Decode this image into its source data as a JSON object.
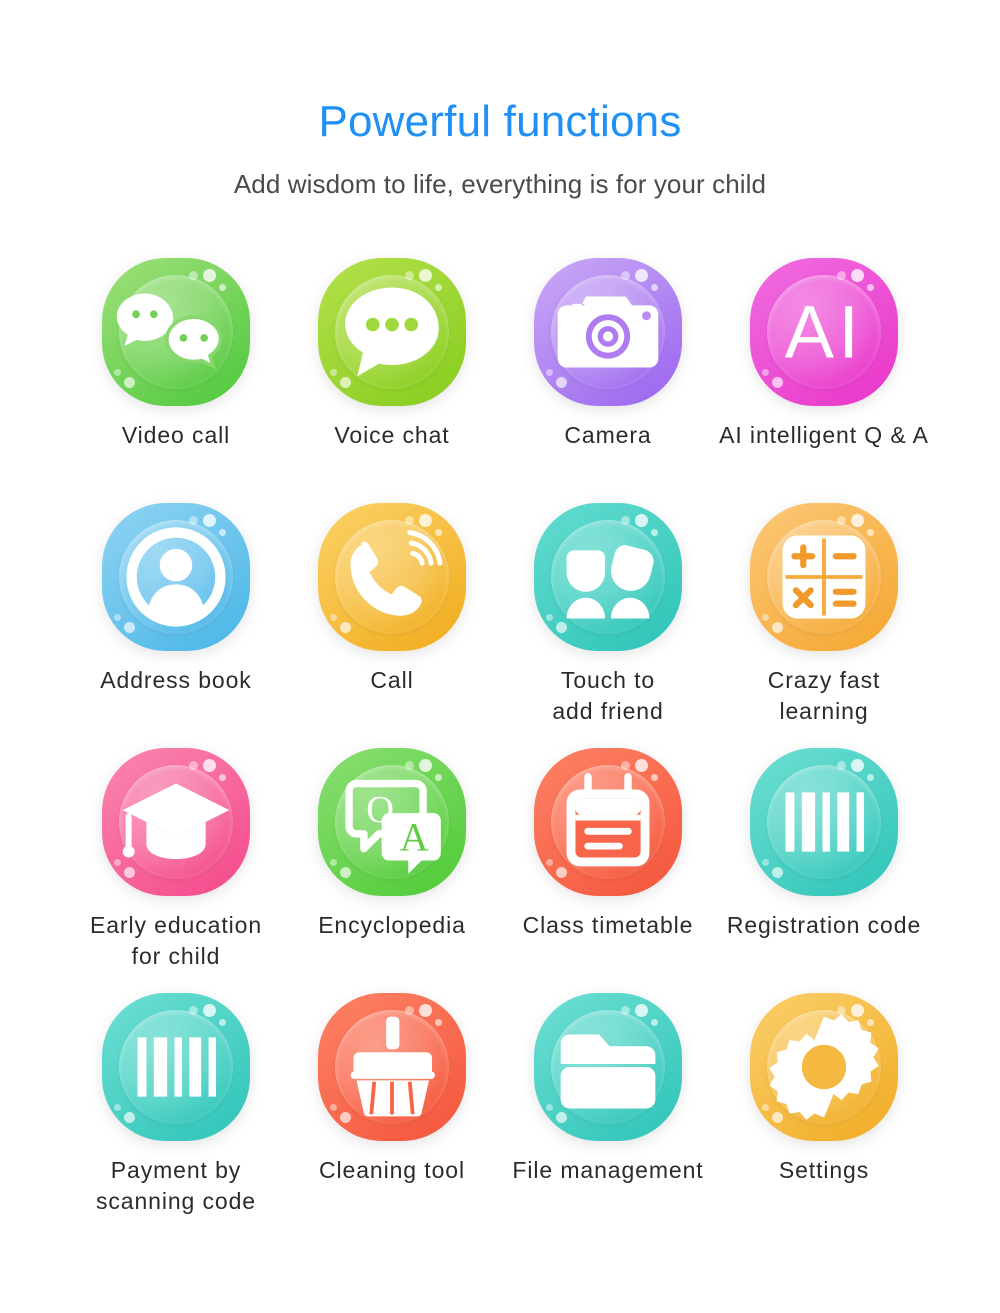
{
  "header": {
    "title": "Powerful functions",
    "subtitle": "Add wisdom to life, everything is for your child",
    "title_color": "#2090f5",
    "subtitle_color": "#4a4a4a"
  },
  "grid": {
    "columns": 4,
    "rows": 4,
    "items": [
      {
        "label": "Video call",
        "icon": "chat-bubbles-icon",
        "color_from": "#9ee07a",
        "color_to": "#4ec83c"
      },
      {
        "label": "Voice chat",
        "icon": "speech-bubble-icon",
        "color_from": "#b4e04a",
        "color_to": "#86cc1e"
      },
      {
        "label": "Camera",
        "icon": "camera-icon",
        "color_from": "#c9aaf5",
        "color_to": "#9a63ef"
      },
      {
        "label": "AI intelligent Q & A",
        "icon": "ai-icon",
        "color_from": "#f06de0",
        "color_to": "#e935c8"
      },
      {
        "label": "Address book",
        "icon": "contact-person-icon",
        "color_from": "#8fd4f2",
        "color_to": "#49b5e8"
      },
      {
        "label": "Call",
        "icon": "phone-call-icon",
        "color_from": "#fcd266",
        "color_to": "#f0ab1c"
      },
      {
        "label": "Touch to\nadd friend",
        "icon": "two-people-icon",
        "color_from": "#63dcd0",
        "color_to": "#2dc4b6"
      },
      {
        "label": "Crazy fast\nlearning",
        "icon": "calculator-icon",
        "color_from": "#fcc878",
        "color_to": "#f5a62e"
      },
      {
        "label": "Early education\nfor child",
        "icon": "graduation-cap-icon",
        "color_from": "#fa86b0",
        "color_to": "#f4488a"
      },
      {
        "label": "Encyclopedia",
        "icon": "qa-bubbles-icon",
        "color_from": "#8ade72",
        "color_to": "#4ecb35"
      },
      {
        "label": "Class timetable",
        "icon": "calendar-icon",
        "color_from": "#fd8266",
        "color_to": "#f4553b"
      },
      {
        "label": "Registration code",
        "icon": "barcode-icon",
        "color_from": "#6ddfd2",
        "color_to": "#2ec4b8"
      },
      {
        "label": "Payment by\nscanning code",
        "icon": "barcode-icon",
        "color_from": "#6ddfd2",
        "color_to": "#2ec4b8"
      },
      {
        "label": "Cleaning tool",
        "icon": "broom-icon",
        "color_from": "#fd8266",
        "color_to": "#f4553b"
      },
      {
        "label": "File management",
        "icon": "folder-icon",
        "color_from": "#6ddfd2",
        "color_to": "#2ec4b8"
      },
      {
        "label": "Settings",
        "icon": "gear-icon",
        "color_from": "#fbcf6a",
        "color_to": "#f0ab24"
      }
    ]
  },
  "icon_text": {
    "ai": "AI",
    "question": "Q",
    "answer": "A",
    "plus": "+",
    "minus": "−",
    "multiply": "×",
    "equals": "="
  }
}
